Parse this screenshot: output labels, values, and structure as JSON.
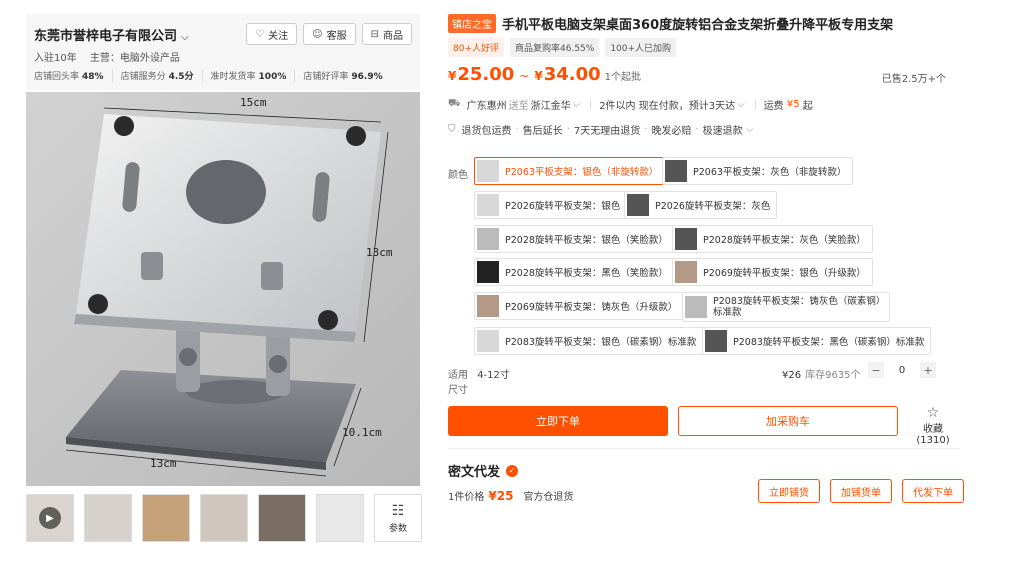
{
  "shop": {
    "name": "东莞市誉梓电子有限公司",
    "chevron": "⌵",
    "buttons": {
      "follow": "关注",
      "service": "客服",
      "goods": "商品"
    },
    "years": "入驻10年",
    "main_business": "主营：电脑外设产品",
    "stats": [
      {
        "label": "店铺回头率",
        "value": "48%"
      },
      {
        "label": "店铺服务分",
        "value": "4.5分"
      },
      {
        "label": "准时发货率",
        "value": "100%"
      },
      {
        "label": "店铺好评率",
        "value": "96.9%"
      }
    ]
  },
  "image": {
    "dim_top": "15cm",
    "dim_right": "13cm",
    "dim_bottom": "13cm",
    "dim_base": "10.1cm",
    "params_label": "参数"
  },
  "product": {
    "store_badge": "镇店之宝",
    "title": "手机平板电脑支架桌面360度旋转铝合金支架折叠升降平板专用支架",
    "tags": [
      "80+人好评",
      "商品复购率46.55%",
      "100+人已加购"
    ],
    "price_currency": "¥",
    "price_low": "25.00",
    "price_high": "34.00",
    "price_tilde": "~",
    "min_order": "1个起批",
    "sold": "已售2.5万+个"
  },
  "shipping": {
    "from": "广东惠州",
    "to_prefix": "送至",
    "to": "浙江金华",
    "timing": "2件以内 现在付款，预计3天达",
    "fee_label": "运费",
    "fee": "¥5",
    "fee_suffix": "起"
  },
  "services": [
    "退货包运费",
    "售后延长",
    "7天无理由退货",
    "晚发必赔",
    "极速退款"
  ],
  "colors": {
    "label": "颜色",
    "options": [
      "P2063平板支架：银色（非旋转款）",
      "P2063平板支架：灰色（非旋转款）",
      "P2026旋转平板支架：银色",
      "P2026旋转平板支架：灰色",
      "P2028旋转平板支架：银色（笑脸款）",
      "P2028旋转平板支架：灰色（笑脸款）",
      "P2028旋转平板支架：黑色（笑脸款）",
      "P2069旋转平板支架：银色（升级款）",
      "P2069旋转平板支架：铸灰色（升级款）",
      "P2083旋转平板支架：铸灰色（碳素钢）标准款",
      "P2083旋转平板支架：银色（碳素钢）标准款",
      "P2083旋转平板支架：黑色（碳素钢）标准款"
    ]
  },
  "size": {
    "label_a": "适用",
    "label_b": "尺寸",
    "value": "4-12寸",
    "price": "¥26",
    "stock": "库存9635个",
    "qty": "0",
    "minus": "−",
    "plus": "+"
  },
  "actions": {
    "buy": "立即下单",
    "cart": "加采购车",
    "fav": "收藏 (1310)"
  },
  "mixed": {
    "title": "密文代发",
    "price_label": "1件价格",
    "price": "¥25",
    "warehouse": "官方仓退货",
    "buttons": [
      "立即铺货",
      "加铺货单",
      "代发下单"
    ]
  }
}
